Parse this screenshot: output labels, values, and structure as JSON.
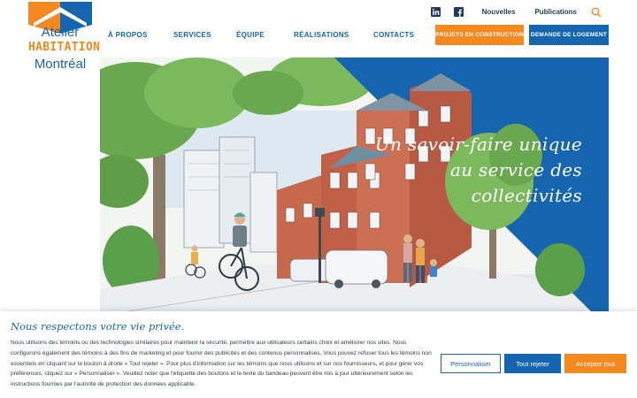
{
  "brand": {
    "line1": "Atelier",
    "line2": "HABITATION",
    "line3": "Montréal",
    "colors": {
      "blue": "#1565b0",
      "orange": "#f4891f",
      "navy": "#1f3a5c"
    }
  },
  "topbar": {
    "icons": [
      "linkedin-icon",
      "facebook-icon",
      "search-icon"
    ],
    "links": [
      "Nouvelles",
      "Publications"
    ]
  },
  "nav": {
    "items": [
      "À PROPOS",
      "SERVICES",
      "ÉQUIPE",
      "RÉALISATIONS",
      "CONTACTS"
    ],
    "cta_projects": "PROJETS EN CONSTRUCTION",
    "cta_housing": "DEMANDE DE LOGEMENT"
  },
  "hero": {
    "tagline_1": "Un savoir-faire unique",
    "tagline_2": "au service des",
    "tagline_3": "collectivités"
  },
  "cookie": {
    "title": "Nous respectons votre vie privée.",
    "text": "Nous utilisons des témoins ou des technologies similaires pour maintenir la sécurité, permettre aux utilisateurs certains choix et améliorer nos sites. Nous configurons également des témoins à des fins de marketing et pour fournir des publicités et des contenus personnalisés. Vous pouvez refuser tous les témoins non essentiels en cliquant sur le bouton à droite « Tout rejeter ». Pour plus d'information sur les témoins que nous utilisons et sur nos fournisseurs, et pour gérer vos préférences, cliquez sur « Personnaliser ». Veuillez noter que l'étiquette des boutons et le texte du bandeau peuvent être mis à jour ultérieurement selon les instructions fournies par l'autorité de protection des données applicable.",
    "btn_custom": "Personnaliser",
    "btn_reject": "Tout rejeter",
    "btn_accept": "Accepter tout"
  }
}
